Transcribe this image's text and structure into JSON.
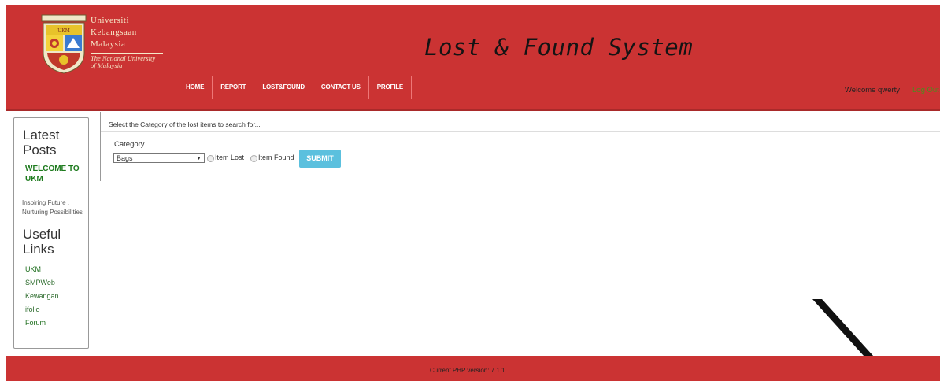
{
  "header": {
    "university_lines": [
      "Universiti",
      "Kebangsaan",
      "Malaysia"
    ],
    "tagline_lines": [
      "The National University",
      "of Malaysia"
    ],
    "title": "Lost & Found System",
    "nav": [
      "HOME",
      "REPORT",
      "LOST&FOUND",
      "CONTACT US",
      "PROFILE"
    ],
    "welcome": "Welcome qwerty",
    "logout": "Log Out",
    "color": "#cb3333"
  },
  "sidebar": {
    "latest_heading": "Latest Posts",
    "welcome_post": "WELCOME TO UKM",
    "tagline": "Inspiring Future , Nurturing Possibilities",
    "links_heading": "Useful Links",
    "links": [
      "UKM",
      "SMPWeb",
      "Kewangan",
      "ifolio",
      "Forum"
    ]
  },
  "main": {
    "intro": "Select the Category of the lost items to search for...",
    "category_label": "Category",
    "category_value": "Bags",
    "radio_lost": "Item Lost",
    "radio_found": "Item Found",
    "submit": "SUBMIT"
  },
  "footer": {
    "php_version": "Current PHP version: 7.1.1"
  }
}
